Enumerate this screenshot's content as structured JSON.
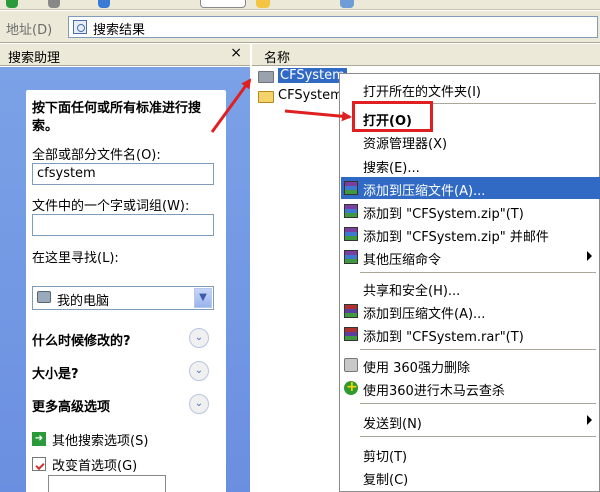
{
  "address": {
    "label": "地址(D)",
    "path": "搜索结果"
  },
  "search_panel": {
    "title": "搜索助理",
    "close": "×",
    "intro": "按下面任何或所有标准进行搜索。",
    "filename_label": "全部或部分文件名(O):",
    "filename_value": "cfsystem",
    "phrase_label": "文件中的一个字或词组(W):",
    "phrase_value": "",
    "lookin_label": "在这里寻找(L):",
    "lookin_value": "我的电脑",
    "when_modified": "什么时候修改的?",
    "size": "大小是?",
    "advanced": "更多高级选项",
    "other_options": "其他搜索选项(S)",
    "change_prefs": "改变首选项(G)",
    "expand_glyph": "⌄"
  },
  "filelist": {
    "column_name": "名称",
    "files": [
      "CFSystem",
      "CFSystem"
    ]
  },
  "context_menu": {
    "items": [
      "打开所在的文件夹(I)",
      "打开(O)",
      "资源管理器(X)",
      "搜索(E)...",
      "添加到压缩文件(A)...",
      "添加到 \"CFSystem.zip\"(T)",
      "添加到 \"CFSystem.zip\" 并邮件",
      "其他压缩命令",
      "共享和安全(H)...",
      "添加到压缩文件(A)...",
      "添加到 \"CFSystem.rar\"(T)",
      "使用 360强力删除",
      "使用360进行木马云查杀",
      "发送到(N)",
      "剪切(T)",
      "复制(C)"
    ]
  },
  "colors": {
    "highlight": "#316ac5",
    "annotation": "#e02020",
    "panel_bg": "#7ba2e7"
  }
}
